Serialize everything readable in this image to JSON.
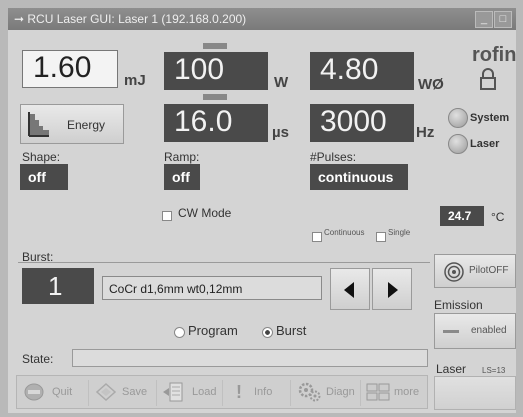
{
  "window": {
    "title": "RCU Laser GUI:  Laser 1 (192.168.0.200)"
  },
  "energy": {
    "value": "1.60",
    "unit": "mJ"
  },
  "power": {
    "value": "100",
    "unit": "W"
  },
  "avg_power": {
    "value": "4.80",
    "unit": "WØ"
  },
  "pulse_width": {
    "value": "16.0",
    "unit": "µs"
  },
  "frequency": {
    "value": "3000",
    "unit": "Hz"
  },
  "brand": "rofin",
  "energy_button": {
    "label": "Energy"
  },
  "status": {
    "system_label": "System",
    "laser_label": "Laser"
  },
  "shape": {
    "label": "Shape:",
    "value": "off"
  },
  "ramp": {
    "label": "Ramp:",
    "value": "off"
  },
  "pulses": {
    "label": "#Pulses:",
    "value": "continuous",
    "continuous_label": "Continuous",
    "single_label": "Single"
  },
  "cw_mode": {
    "label": "CW Mode"
  },
  "temperature": {
    "value": "24.7",
    "unit": "°C"
  },
  "burst": {
    "label": "Burst:",
    "value": "1",
    "program_name": "CoCr d1,6mm wt0,12mm"
  },
  "pilot": {
    "label": "PilotOFF"
  },
  "emission": {
    "label": "Emission",
    "button": "enabled"
  },
  "mode": {
    "program_label": "Program",
    "burst_label": "Burst"
  },
  "state": {
    "label": "State:",
    "value": ""
  },
  "laser_info": {
    "label": "Laser",
    "id": "LS=13"
  },
  "toolbar": {
    "quit": "Quit",
    "save": "Save",
    "load": "Load",
    "info": "Info",
    "diagn": "Diagn",
    "more": "more"
  }
}
